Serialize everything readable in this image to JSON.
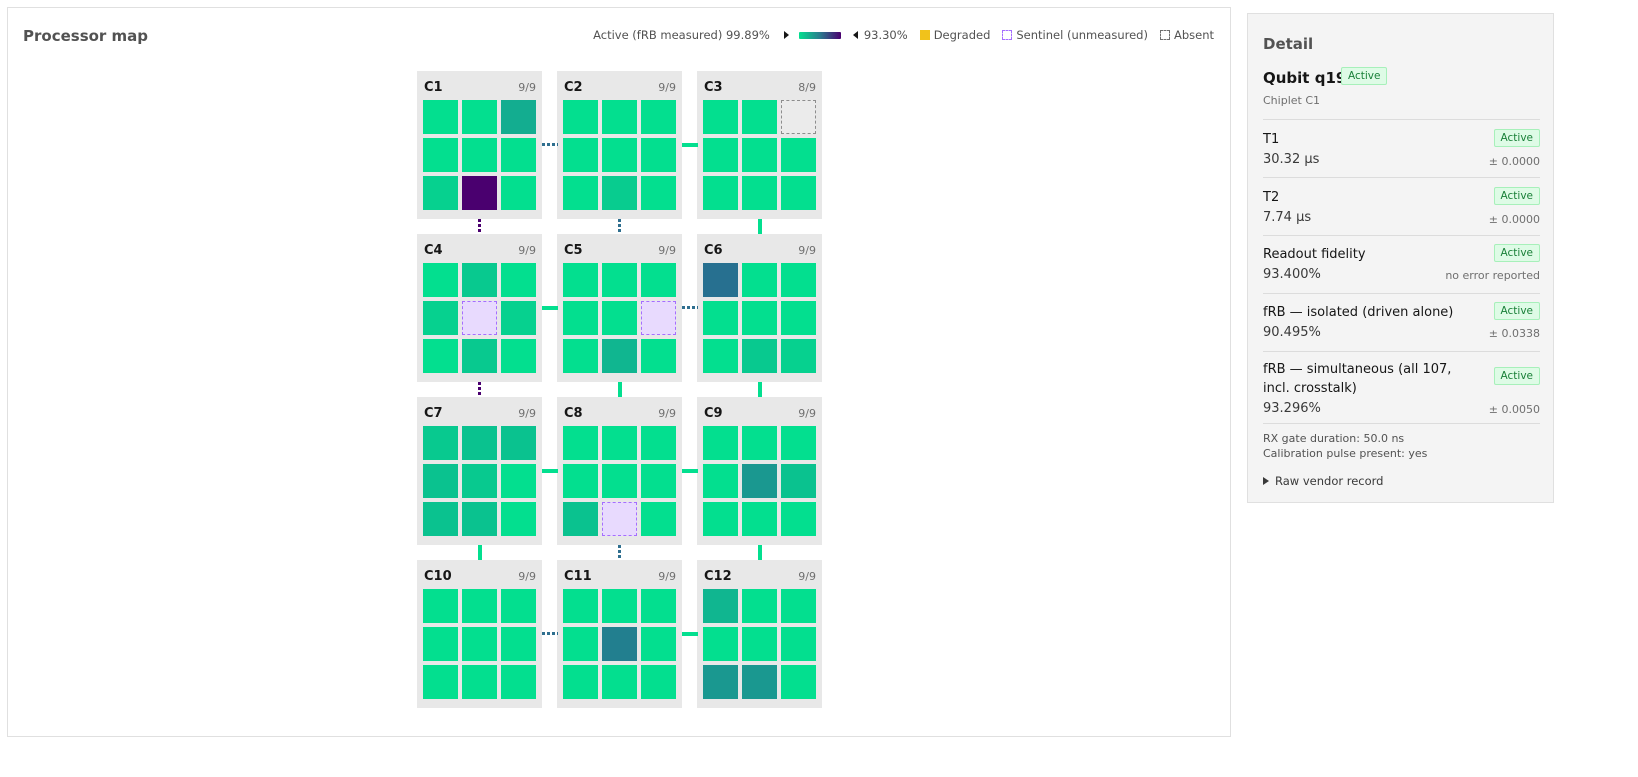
{
  "map": {
    "title": "Processor map",
    "legend": {
      "active_label": "Active (fRB measured) 99.89%",
      "active_min_label": "93.30%",
      "degraded_label": "Degraded",
      "sentinel_label": "Sentinel (unmeasured)",
      "absent_label": "Absent"
    },
    "chiplets": [
      {
        "name": "C1",
        "count": "9/9",
        "qubits": [
          "#03df8f",
          "#03df8f",
          "#13ad90",
          "#03df8f",
          "#03df8f",
          "#03df8f",
          "#06d18f",
          "#4a006f",
          "#03df8f"
        ]
      },
      {
        "name": "C2",
        "count": "9/9",
        "qubits": [
          "#03df8f",
          "#03df8f",
          "#03df8f",
          "#03df8f",
          "#03df8f",
          "#03df8f",
          "#03df8f",
          "#08cc8f",
          "#03df8f"
        ]
      },
      {
        "name": "C3",
        "count": "8/9",
        "qubits": [
          "#03df8f",
          "#03df8f",
          "absent",
          "#03df8f",
          "#03df8f",
          "#03df8f",
          "#03df8f",
          "#03df8f",
          "#03df8f"
        ]
      },
      {
        "name": "C4",
        "count": "9/9",
        "qubits": [
          "#03df8f",
          "#08c98f",
          "#03df8f",
          "#06d18f",
          "sentinel",
          "#06d18f",
          "#03df8f",
          "#08c98f",
          "#03df8f"
        ]
      },
      {
        "name": "C5",
        "count": "9/9",
        "qubits": [
          "#03df8f",
          "#03df8f",
          "#03df8f",
          "#03df8f",
          "#03df8f",
          "sentinel",
          "#03df8f",
          "#10b690",
          "#03df8f"
        ]
      },
      {
        "name": "C6",
        "count": "9/9",
        "qubits": [
          "#277090",
          "#03df8f",
          "#03df8f",
          "#03df8f",
          "#03df8f",
          "#03df8f",
          "#03df8f",
          "#08c98f",
          "#06d18f"
        ]
      },
      {
        "name": "C7",
        "count": "9/9",
        "qubits": [
          "#08c98f",
          "#0ac28f",
          "#0ac28f",
          "#0ac28f",
          "#08c98f",
          "#03df8f",
          "#0ac28f",
          "#0ac28f",
          "#03df8f"
        ]
      },
      {
        "name": "C8",
        "count": "9/9",
        "qubits": [
          "#03df8f",
          "#03df8f",
          "#03df8f",
          "#03df8f",
          "#03df8f",
          "#03df8f",
          "#0ac28f",
          "sentinel",
          "#03df8f"
        ]
      },
      {
        "name": "C9",
        "count": "9/9",
        "qubits": [
          "#03df8f",
          "#03df8f",
          "#03df8f",
          "#03df8f",
          "#1a9890",
          "#0ac28f",
          "#03df8f",
          "#03df8f",
          "#03df8f"
        ]
      },
      {
        "name": "C10",
        "count": "9/9",
        "qubits": [
          "#03df8f",
          "#03df8f",
          "#03df8f",
          "#03df8f",
          "#03df8f",
          "#03df8f",
          "#03df8f",
          "#03df8f",
          "#03df8f"
        ]
      },
      {
        "name": "C11",
        "count": "9/9",
        "qubits": [
          "#03df8f",
          "#03df8f",
          "#03df8f",
          "#03df8f",
          "#227f8f",
          "#03df8f",
          "#03df8f",
          "#03df8f",
          "#03df8f"
        ]
      },
      {
        "name": "C12",
        "count": "9/9",
        "qubits": [
          "#10b690",
          "#03df8f",
          "#03df8f",
          "#03df8f",
          "#03df8f",
          "#03df8f",
          "#1a9890",
          "#1a9890",
          "#03df8f"
        ]
      }
    ],
    "links_h": [
      {
        "from": "C1",
        "to": "C2",
        "color": "#2f6f8f",
        "dashed": true
      },
      {
        "from": "C2",
        "to": "C3",
        "color": "#03df8f",
        "dashed": false
      },
      {
        "from": "C4",
        "to": "C5",
        "color": "#03df8f",
        "dashed": false
      },
      {
        "from": "C5",
        "to": "C6",
        "color": "#2f6f8f",
        "dashed": true
      },
      {
        "from": "C7",
        "to": "C8",
        "color": "#03df8f",
        "dashed": false
      },
      {
        "from": "C8",
        "to": "C9",
        "color": "#03df8f",
        "dashed": false
      },
      {
        "from": "C10",
        "to": "C11",
        "color": "#2f6f8f",
        "dashed": true
      },
      {
        "from": "C11",
        "to": "C12",
        "color": "#03df8f",
        "dashed": false
      }
    ],
    "links_v": [
      {
        "from": "C1",
        "to": "C4",
        "color": "#4a006f",
        "dashed": true
      },
      {
        "from": "C2",
        "to": "C5",
        "color": "#2f6f8f",
        "dashed": true
      },
      {
        "from": "C3",
        "to": "C6",
        "color": "#03df8f",
        "dashed": false
      },
      {
        "from": "C4",
        "to": "C7",
        "color": "#4a006f",
        "dashed": true
      },
      {
        "from": "C5",
        "to": "C8",
        "color": "#03df8f",
        "dashed": false
      },
      {
        "from": "C6",
        "to": "C9",
        "color": "#03df8f",
        "dashed": false
      },
      {
        "from": "C7",
        "to": "C10",
        "color": "#03df8f",
        "dashed": false
      },
      {
        "from": "C8",
        "to": "C11",
        "color": "#2f6f8f",
        "dashed": true
      },
      {
        "from": "C9",
        "to": "C12",
        "color": "#03df8f",
        "dashed": false
      }
    ]
  },
  "detail": {
    "title": "Detail",
    "qubit_name": "Qubit q19",
    "qubit_status": "Active",
    "chiplet": "Chiplet C1",
    "metrics": [
      {
        "label": "T1",
        "value": "30.32 μs",
        "error": "± 0.0000",
        "status": "Active"
      },
      {
        "label": "T2",
        "value": "7.74 μs",
        "error": "± 0.0000",
        "status": "Active"
      },
      {
        "label": "Readout fidelity",
        "value": "93.400%",
        "error": "no error reported",
        "status": "Active"
      },
      {
        "label": "fRB — isolated (driven alone)",
        "value": "90.495%",
        "error": "± 0.0338",
        "status": "Active"
      },
      {
        "label": "fRB — simultaneous (all 107, incl. crosstalk)",
        "value": "93.296%",
        "error": "± 0.0050",
        "status": "Active"
      }
    ],
    "rx_gate": "RX gate duration: 50.0 ns",
    "calibration": "Calibration pulse present: yes",
    "raw_record": "Raw vendor record"
  },
  "colors": {
    "active_high": "#03df8f",
    "active_low": "#4a006f",
    "degraded": "#f1c21b",
    "sentinel": "#a56eff",
    "status_green": "#198038"
  }
}
